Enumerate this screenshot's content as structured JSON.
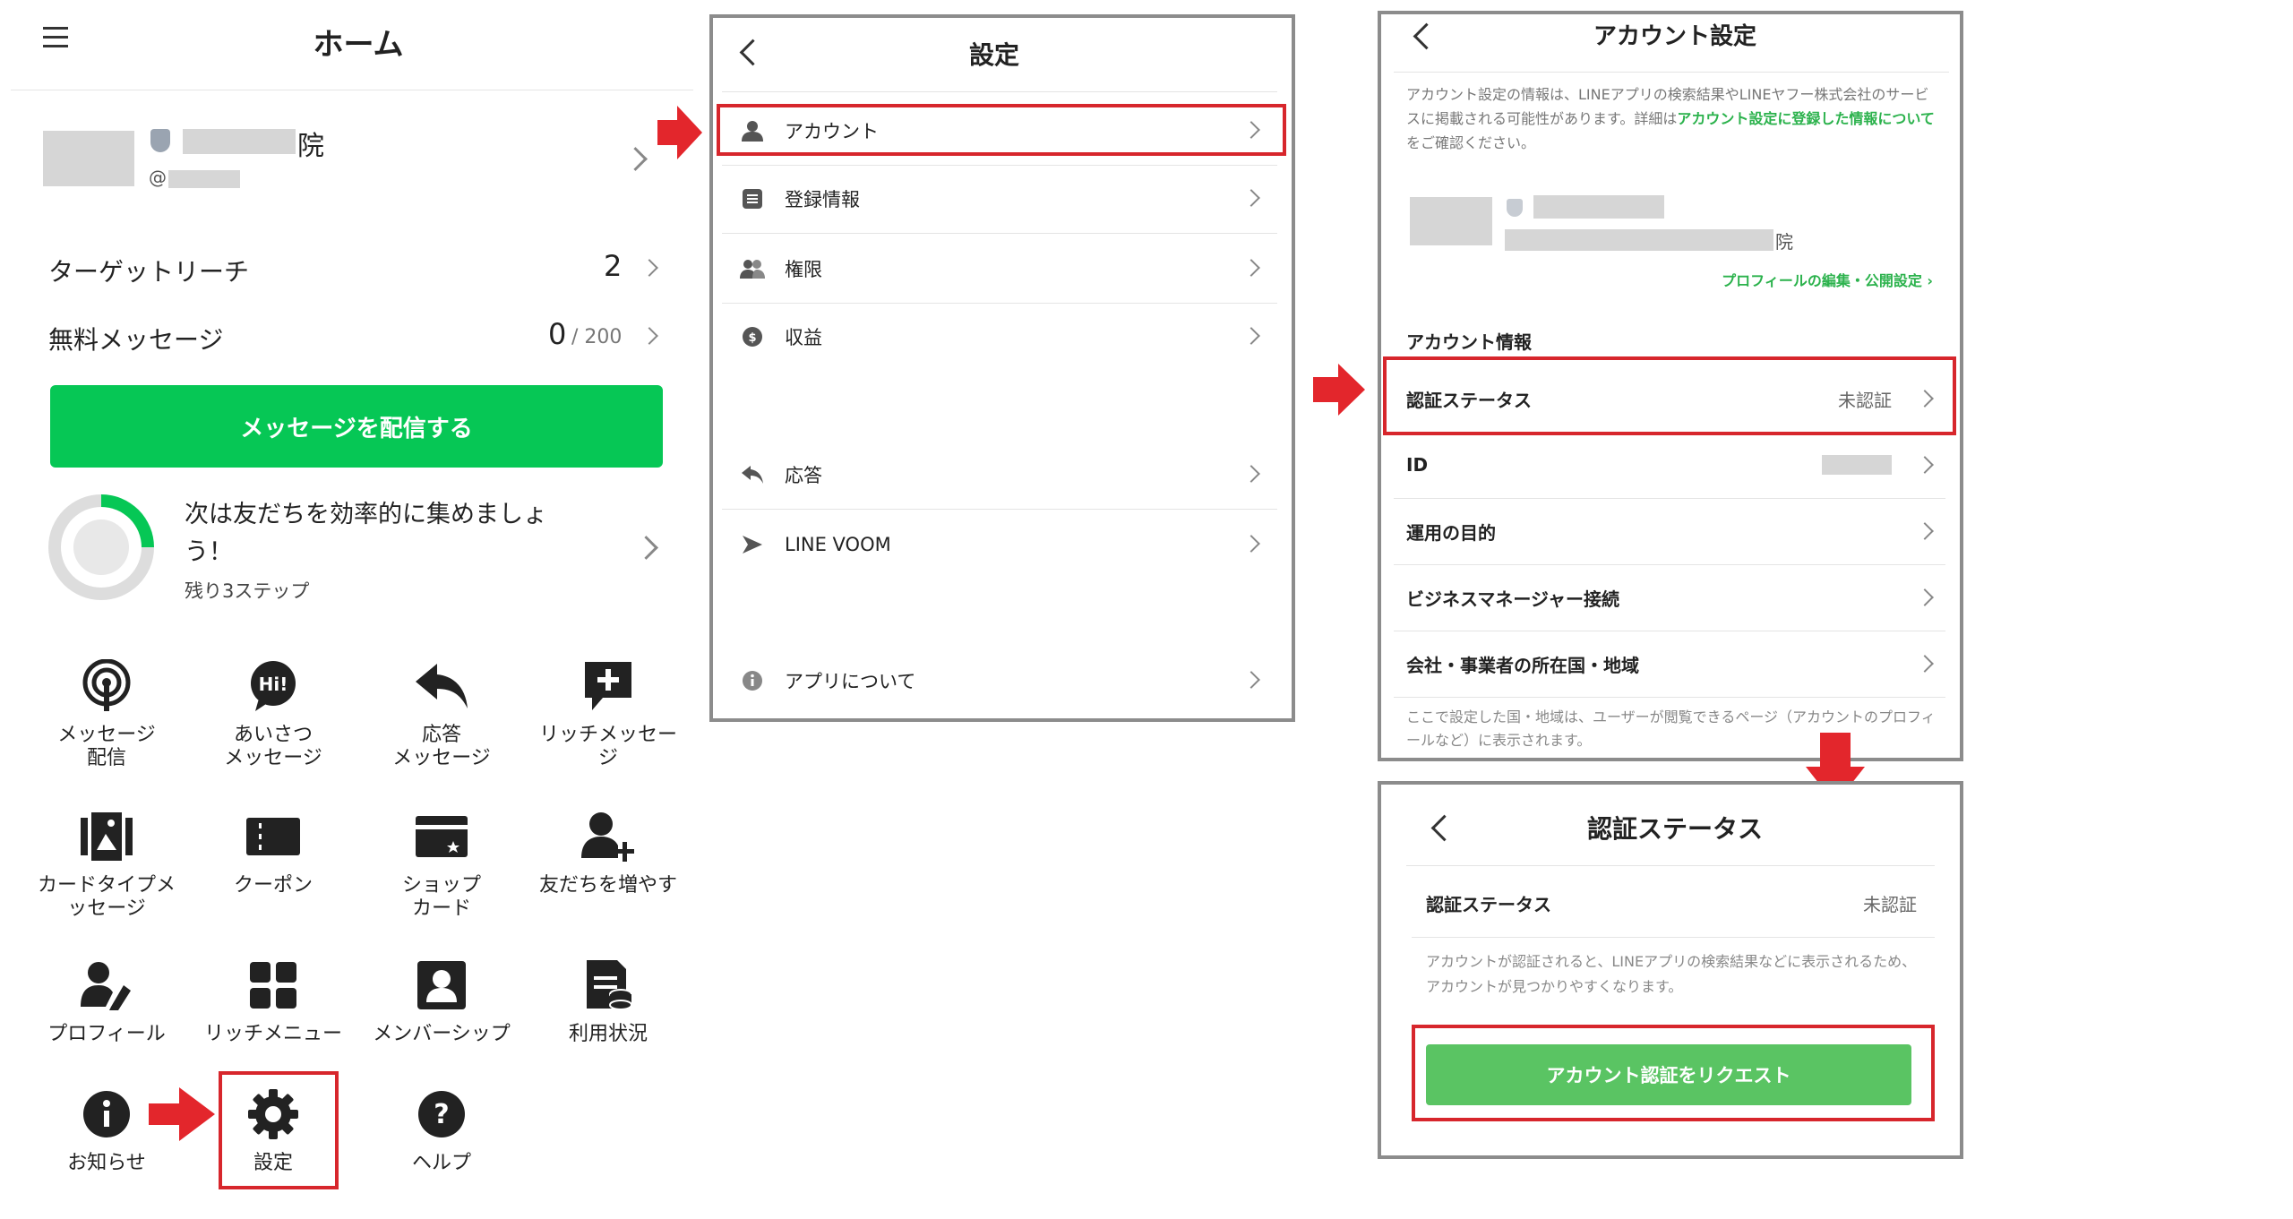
{
  "home": {
    "title": "ホーム",
    "account_suffix": "院",
    "account_handle_prefix": "@",
    "target_reach_label": "ターゲットリーチ",
    "target_reach_value": "2",
    "free_messages_label": "無料メッセージ",
    "free_messages_value": "0",
    "free_messages_total": "/ 200",
    "broadcast_button": "メッセージを配信する",
    "progress_title": "次は友だちを効率的に集めましょう！",
    "progress_remaining": "残り3ステップ",
    "tiles": [
      {
        "label": "メッセージ\n配信",
        "icon": "broadcast-icon"
      },
      {
        "label": "あいさつ\nメッセージ",
        "icon": "hi-bubble-icon"
      },
      {
        "label": "応答\nメッセージ",
        "icon": "reply-icon"
      },
      {
        "label": "リッチメッセー\nジ",
        "icon": "rich-message-icon"
      },
      {
        "label": "カードタイプメ\nッセージ",
        "icon": "card-message-icon"
      },
      {
        "label": "クーポン",
        "icon": "coupon-icon"
      },
      {
        "label": "ショップ\nカード",
        "icon": "shop-card-icon"
      },
      {
        "label": "友だちを増やす",
        "icon": "add-friend-icon"
      },
      {
        "label": "プロフィール",
        "icon": "profile-edit-icon"
      },
      {
        "label": "リッチメニュー",
        "icon": "rich-menu-icon"
      },
      {
        "label": "メンバーシップ",
        "icon": "membership-icon"
      },
      {
        "label": "利用状況",
        "icon": "usage-icon"
      },
      {
        "label": "お知らせ",
        "icon": "info-icon"
      },
      {
        "label": "設定",
        "icon": "gear-icon"
      },
      {
        "label": "ヘルプ",
        "icon": "help-icon"
      }
    ]
  },
  "settings": {
    "title": "設定",
    "items": [
      {
        "label": "アカウント",
        "icon": "person-icon"
      },
      {
        "label": "登録情報",
        "icon": "list-icon"
      },
      {
        "label": "権限",
        "icon": "people-icon"
      },
      {
        "label": "収益",
        "icon": "dollar-icon"
      },
      {
        "label": "応答",
        "icon": "reply-icon"
      },
      {
        "label": "LINE VOOM",
        "icon": "voom-icon"
      },
      {
        "label": "アプリについて",
        "icon": "info-icon"
      }
    ]
  },
  "account_settings": {
    "title": "アカウント設定",
    "notice_part1": "アカウント設定の情報は、LINEアプリの検索結果やLINEヤフー株式会社のサービスに掲載される可能性があります。詳細は",
    "notice_link": "アカウント設定に登録した情報について",
    "notice_part2": "をご確認ください。",
    "account_suffix": "院",
    "profile_link": "プロフィールの編集・公開設定 ›",
    "section_title": "アカウント情報",
    "rows": [
      {
        "label": "認証ステータス",
        "value": "未認証"
      },
      {
        "label": "ID",
        "value": "@"
      },
      {
        "label": "運用の目的",
        "value": ""
      },
      {
        "label": "ビジネスマネージャー接続",
        "value": ""
      },
      {
        "label": "会社・事業者の所在国・地域",
        "value": ""
      }
    ],
    "footer_note": "ここで設定した国・地域は、ユーザーが閲覧できるページ（アカウントのプロフィールなど）に表示されます。"
  },
  "verification": {
    "title": "認証ステータス",
    "row_label": "認証ステータス",
    "row_value": "未認証",
    "description": "アカウントが認証されると、LINEアプリの検索結果などに表示されるため、アカウントが見つかりやすくなります。",
    "request_button": "アカウント認証をリクエスト"
  },
  "colors": {
    "line_green": "#06c755",
    "button_green": "#5ac463",
    "link_green": "#2bb24c",
    "highlight_red": "#d7262c",
    "panel_border": "#8c8c8c"
  }
}
